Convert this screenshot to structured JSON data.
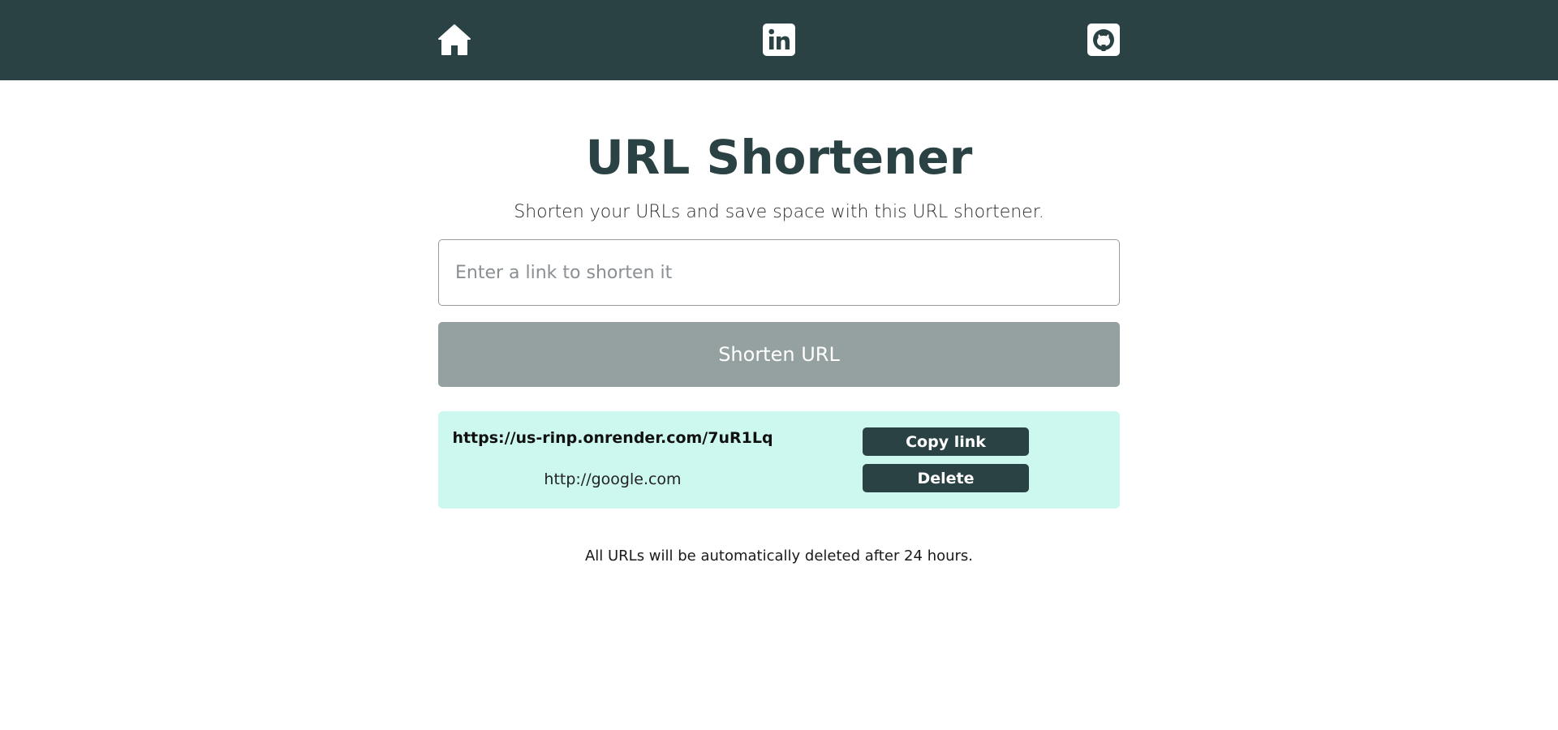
{
  "nav": {
    "items": [
      {
        "icon": "home-icon"
      },
      {
        "icon": "linkedin-icon"
      },
      {
        "icon": "github-icon"
      }
    ]
  },
  "colors": {
    "primary": "#2b4245",
    "disabled_button": "#95a1a1",
    "result_background": "#cdf8ef"
  },
  "page": {
    "title": "URL Shortener",
    "subtitle": "Shorten your URLs and save space with this URL shortener."
  },
  "form": {
    "input_value": "",
    "input_placeholder": "Enter a link to shorten it",
    "submit_label": "Shorten URL"
  },
  "results": [
    {
      "short_url": "https://us-rinp.onrender.com/7uR1Lq",
      "original_url": "http://google.com",
      "copy_label": "Copy link",
      "delete_label": "Delete"
    }
  ],
  "footer": {
    "note": "All URLs will be automatically deleted after 24 hours."
  }
}
